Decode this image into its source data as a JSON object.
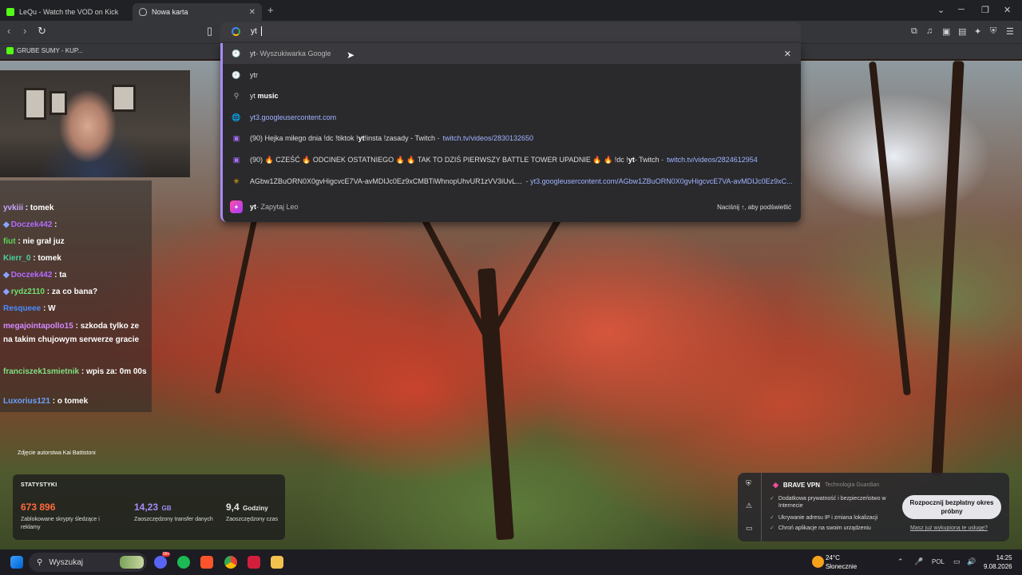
{
  "browser": {
    "tabs": [
      {
        "title": "LeQu - Watch the VOD on Kick",
        "active": false
      },
      {
        "title": "Nowa karta",
        "active": true
      }
    ],
    "address_value": "yt",
    "bookmark": "GRUBE SUMY - KUP..."
  },
  "suggestions": [
    {
      "icon": "history-icon",
      "main": "yt",
      "muted": " - Wyszukiwarka Google",
      "url": ""
    },
    {
      "icon": "history-icon",
      "main": "ytr",
      "muted": "",
      "url": ""
    },
    {
      "icon": "search-icon",
      "main": "yt ",
      "bold": "music",
      "url": ""
    },
    {
      "icon": "globe-icon",
      "main": "",
      "url": "yt3.googleusercontent.com"
    },
    {
      "icon": "twitch-icon",
      "main": "(90) Hejka miłego dnia !dc !tiktok !",
      "bold": "yt",
      "rest": " !insta !zasady - Twitch",
      "url": "twitch.tv/videos/2830132650"
    },
    {
      "icon": "twitch-icon",
      "main": "(90) 🔥 CZEŚĆ 🔥 ODCINEK OSTATNIEGO 🔥 🔥 TAK TO DZIŚ PIERWSZY BATTLE TOWER UPADNIE 🔥 🔥 !dc !",
      "bold": "yt",
      "rest": " - Twitch",
      "url": "twitch.tv/videos/2824612954"
    },
    {
      "icon": "google-photos-icon",
      "main": "AGbw1ZBuORN0X0gvHigcvcE7VA-avMDIJc0Ez9xCMBTiWhnopUhvUR1zVV3iUvL...",
      "url": "yt3.googleusercontent.com/AGbw1ZBuORN0X0gvHigcvcE7VA-avMDIJc0Ez9xC..."
    },
    {
      "icon": "leo-icon",
      "main": "yt",
      "muted": " - Zapytaj Leo",
      "hint": "Naciśnij ↑, aby podświetlić"
    }
  ],
  "chat": [
    {
      "user": "yvkiii",
      "color": "#c9a6ff",
      "text": "tomek"
    },
    {
      "user": "Doczek442",
      "color": "#b36bff",
      "text": "",
      "badge": true
    },
    {
      "user": "fiut",
      "color": "#5cd65c",
      "text": "nie grał juz"
    },
    {
      "user": "Kierr_0",
      "color": "#49d1a3",
      "text": "tomek"
    },
    {
      "user": "Doczek442",
      "color": "#b36bff",
      "text": "ta",
      "badge": true
    },
    {
      "user": "rydz2110",
      "color": "#6fe06f",
      "text": "za co bana?",
      "badge": true
    },
    {
      "user": "Resqueee",
      "color": "#4a8cff",
      "text": "W"
    },
    {
      "user": "megajointapollo15",
      "color": "#d28bff",
      "text": "szkoda tylko ze na takim chujowym serwerze gracie"
    },
    {
      "user": "franciszek1smietnik",
      "color": "#7fe07f",
      "text": "wpis za: 0m 00s"
    },
    {
      "user": "Luxorius121",
      "color": "#6aa0ff",
      "text": "o tomek"
    }
  ],
  "credit": "Zdjęcie autorstwa Kai Battistoni",
  "stats": {
    "title": "STATYSTYKI",
    "items": [
      {
        "value": "673 896",
        "unit": "",
        "desc": "Zablokowane skrypty śledzące i reklamy",
        "color": "#ff6a3d"
      },
      {
        "value": "14,23",
        "unit": "GB",
        "desc": "Zaoszczędzony transfer danych",
        "color": "#a78bfa"
      },
      {
        "value": "9,4",
        "unit": "Godziny",
        "desc": "Zaoszczędzony czas",
        "color": "#ffffff"
      }
    ]
  },
  "vpn": {
    "title": "BRAVE VPN",
    "tech": "Technologia  Guardian",
    "features": [
      "Dodatkowa prywatność i bezpieczeństwo w Internecie",
      "Ukrywanie adresu IP i zmiana lokalizacji",
      "Chroń aplikacje na swoim urządzeniu"
    ],
    "cta": "Rozpocznij bezpłatny okres próbny",
    "link": "Masz już wykupioną te usługę?"
  },
  "taskbar": {
    "search": "Wyszukaj",
    "temp": "24°C",
    "weather": "Słonecznie",
    "lang": "POL",
    "time": "14:25",
    "date": "9.08.2026",
    "badge": "99+"
  }
}
